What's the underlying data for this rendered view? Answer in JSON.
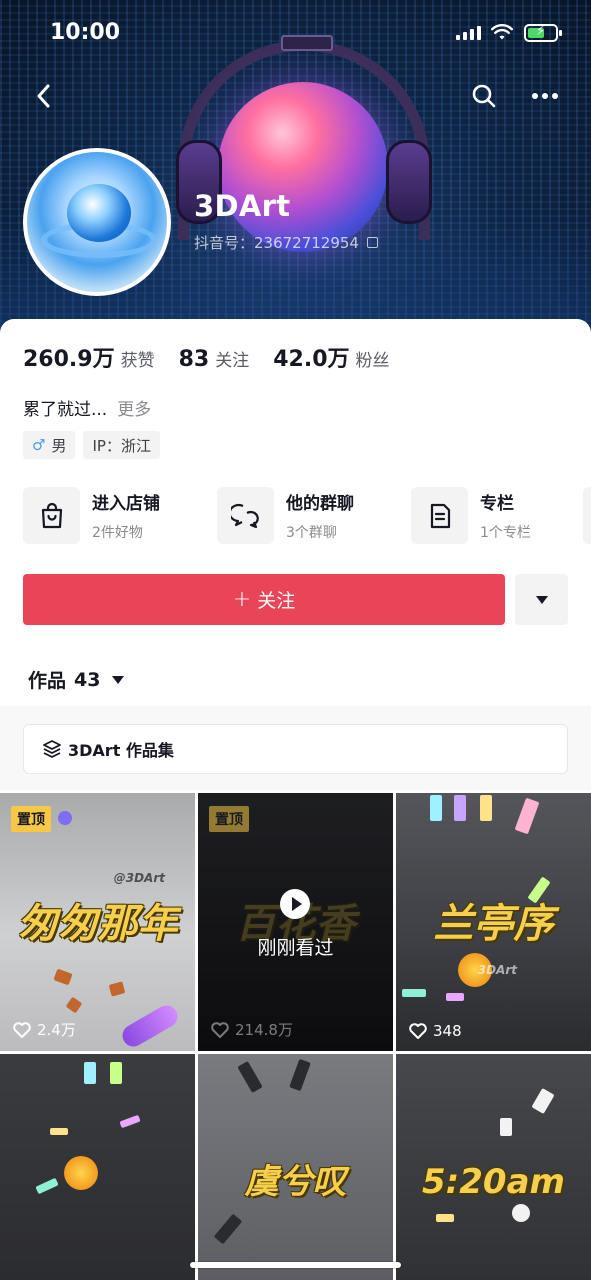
{
  "status_bar": {
    "time": "10:00"
  },
  "profile": {
    "name": "3DArt",
    "douyin_id": "抖音号：23672712954"
  },
  "stats": [
    {
      "value": "260.9万",
      "label": "获赞"
    },
    {
      "value": "83",
      "label": "关注"
    },
    {
      "value": "42.0万",
      "label": "粉丝"
    }
  ],
  "bio": {
    "text": "累了就过...",
    "more": "更多"
  },
  "tags": {
    "gender_icon": "♂",
    "gender": "男",
    "ip": "IP：浙江"
  },
  "services": [
    {
      "icon": "shopping-bag-icon",
      "title": "进入店铺",
      "subtitle": "2件好物"
    },
    {
      "icon": "group-chat-icon",
      "title": "他的群聊",
      "subtitle": "3个群聊"
    },
    {
      "icon": "column-icon",
      "title": "专栏",
      "subtitle": "1个专栏"
    }
  ],
  "follow_button": {
    "plus": "+",
    "label": "关注"
  },
  "works": {
    "label": "作品",
    "count": "43"
  },
  "collection": {
    "label": "3DArt 作品集"
  },
  "videos": [
    {
      "pinned": "置顶",
      "title": "匆匆那年",
      "watermark": "@3DArt",
      "likes": "2.4万"
    },
    {
      "pinned": "置顶",
      "title": "百花香",
      "overlay": "刚刚看过",
      "likes": "214.8万"
    },
    {
      "title": "兰亭序",
      "watermark": "3DArt",
      "likes": "348"
    },
    {
      "title": ""
    },
    {
      "title": "虞兮叹"
    },
    {
      "title": "5:20am"
    }
  ],
  "colors": {
    "follow": "#ea4459",
    "pin": "#f6c843",
    "title_yellow": "#f6d04d"
  }
}
